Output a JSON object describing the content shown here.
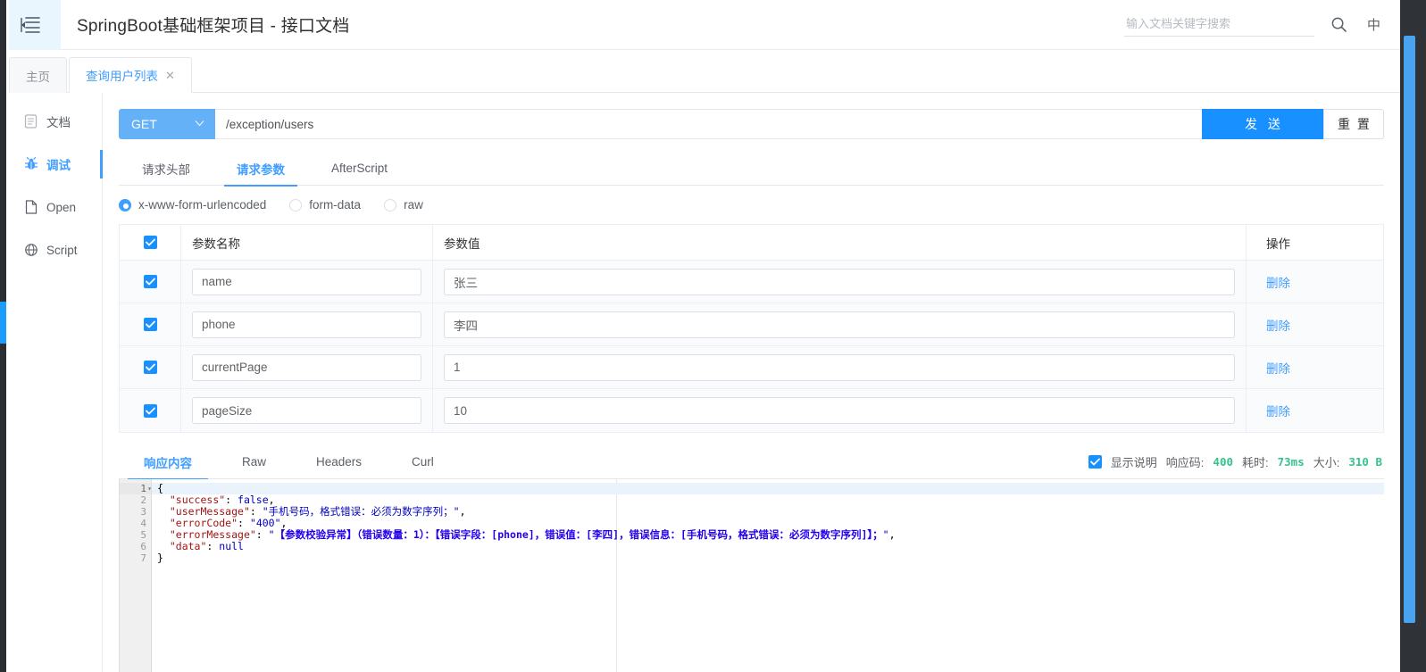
{
  "header": {
    "menu_icon": "menu-collapse-icon",
    "title": "SpringBoot基础框架项目 - 接口文档",
    "search_placeholder": "输入文档关键字搜索",
    "search_value": "",
    "search_icon": "search-icon",
    "lang_label": "中"
  },
  "doc_tabs": [
    {
      "label": "主页",
      "active": false,
      "closable": false
    },
    {
      "label": "查询用户列表",
      "active": true,
      "closable": true,
      "close_glyph": "✕"
    }
  ],
  "sidebar": {
    "items": [
      {
        "label": "文档",
        "icon": "document-icon",
        "active": false
      },
      {
        "label": "调试",
        "icon": "bug-icon",
        "active": true
      },
      {
        "label": "Open",
        "icon": "file-icon",
        "active": false
      },
      {
        "label": "Script",
        "icon": "script-icon",
        "active": false
      }
    ]
  },
  "request": {
    "method": "GET",
    "method_chevron": "chevron-down-icon",
    "url": "/exception/users",
    "url_placeholder": "",
    "send_label": "发 送",
    "reset_label": "重 置",
    "tabs": [
      {
        "label": "请求头部",
        "active": false
      },
      {
        "label": "请求参数",
        "active": true
      },
      {
        "label": "AfterScript",
        "active": false
      }
    ],
    "body_types": [
      {
        "label": "x-www-form-urlencoded",
        "selected": true
      },
      {
        "label": "form-data",
        "selected": false
      },
      {
        "label": "raw",
        "selected": false
      }
    ],
    "table": {
      "headers": [
        "",
        "参数名称",
        "参数值",
        "操作"
      ],
      "header_all_checked": true,
      "delete_label": "删除",
      "rows": [
        {
          "checked": true,
          "name": "name",
          "value": "张三"
        },
        {
          "checked": true,
          "name": "phone",
          "value": "李四"
        },
        {
          "checked": true,
          "name": "currentPage",
          "value": "1"
        },
        {
          "checked": true,
          "name": "pageSize",
          "value": "10"
        }
      ]
    }
  },
  "response": {
    "tabs": [
      {
        "label": "响应内容",
        "active": true
      },
      {
        "label": "Raw",
        "active": false
      },
      {
        "label": "Headers",
        "active": false
      },
      {
        "label": "Curl",
        "active": false
      }
    ],
    "show_desc_checked": true,
    "show_desc_label": "显示说明",
    "status_key": "响应码:",
    "status_value": "400",
    "time_key": "耗时:",
    "time_value": "73ms",
    "size_key": "大小:",
    "size_value": "310 B",
    "line_numbers": [
      "1",
      "2",
      "3",
      "4",
      "5",
      "6",
      "7"
    ],
    "fold_glyph": "▾",
    "code_lines": [
      {
        "n": 1,
        "segments": [
          {
            "t": "{",
            "c": "p"
          }
        ]
      },
      {
        "n": 2,
        "segments": [
          {
            "t": "  ",
            "c": "p"
          },
          {
            "t": "\"success\"",
            "c": "k"
          },
          {
            "t": ": ",
            "c": "p"
          },
          {
            "t": "false",
            "c": "b"
          },
          {
            "t": ",",
            "c": "p"
          }
        ]
      },
      {
        "n": 3,
        "segments": [
          {
            "t": "  ",
            "c": "p"
          },
          {
            "t": "\"userMessage\"",
            "c": "k"
          },
          {
            "t": ": ",
            "c": "p"
          },
          {
            "t": "\"手机号码，格式错误：必须为数字序列；\"",
            "c": "b"
          },
          {
            "t": ",",
            "c": "p"
          }
        ]
      },
      {
        "n": 4,
        "segments": [
          {
            "t": "  ",
            "c": "p"
          },
          {
            "t": "\"errorCode\"",
            "c": "k"
          },
          {
            "t": ": ",
            "c": "p"
          },
          {
            "t": "\"400\"",
            "c": "b"
          },
          {
            "t": ",",
            "c": "p"
          }
        ]
      },
      {
        "n": 5,
        "segments": [
          {
            "t": "  ",
            "c": "p"
          },
          {
            "t": "\"errorMessage\"",
            "c": "k"
          },
          {
            "t": ": ",
            "c": "p"
          },
          {
            "t": "\"",
            "c": "b"
          },
          {
            "t": "【参数校验异常】（错误数量：1）：【错误字段：[phone]，错误值：[李四]，错误信息：[手机号码，格式错误：必须为数字序列]】；",
            "c": "hl"
          },
          {
            "t": "\"",
            "c": "b"
          },
          {
            "t": ",",
            "c": "p"
          }
        ]
      },
      {
        "n": 6,
        "segments": [
          {
            "t": "  ",
            "c": "p"
          },
          {
            "t": "\"data\"",
            "c": "k"
          },
          {
            "t": ": ",
            "c": "p"
          },
          {
            "t": "null",
            "c": "b"
          }
        ]
      },
      {
        "n": 7,
        "segments": [
          {
            "t": "}",
            "c": "p"
          }
        ]
      }
    ]
  },
  "colors": {
    "primary": "#409eff",
    "send_button": "#1890ff",
    "method_bg": "#64b1f7",
    "success_green": "#36c28a",
    "scrollbar_blue": "#4aa3f0",
    "code_highlight": "#2200ee"
  }
}
